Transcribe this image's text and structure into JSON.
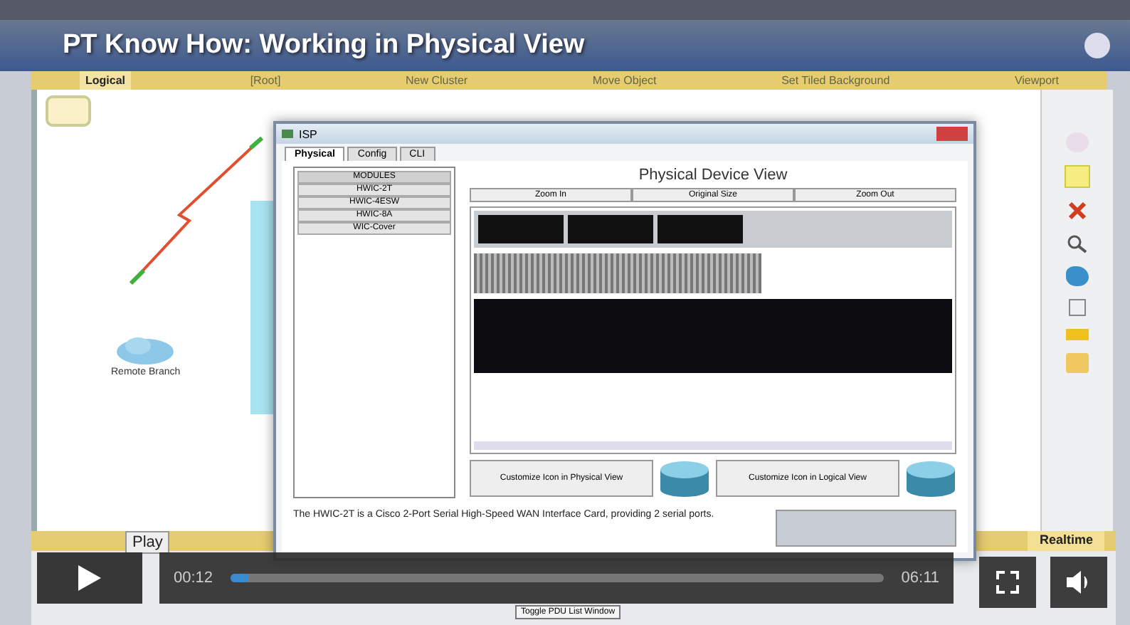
{
  "video_title": "PT Know How: Working in Physical View",
  "toolbar": {
    "items": [
      {
        "label": "Logical",
        "selected": true
      },
      {
        "label": "[Root]",
        "selected": false
      },
      {
        "label": "New Cluster",
        "selected": false
      },
      {
        "label": "Move Object",
        "selected": false
      },
      {
        "label": "Set Tiled Background",
        "selected": false
      },
      {
        "label": "Viewport",
        "selected": false
      }
    ]
  },
  "workspace": {
    "device_label": "Remote Branch"
  },
  "dialog": {
    "title": "ISP",
    "tabs": [
      {
        "label": "Physical",
        "selected": true
      },
      {
        "label": "Config",
        "selected": false
      },
      {
        "label": "CLI",
        "selected": false
      }
    ],
    "modules": [
      {
        "label": "MODULES",
        "kind": "header"
      },
      {
        "label": "HWIC-2T",
        "kind": "item"
      },
      {
        "label": "HWIC-4ESW",
        "kind": "item"
      },
      {
        "label": "HWIC-8A",
        "kind": "item"
      },
      {
        "label": "WIC-Cover",
        "kind": "item"
      }
    ],
    "view_title": "Physical Device View",
    "zoom_buttons": [
      "Zoom In",
      "Original Size",
      "Zoom Out"
    ],
    "customize_buttons": [
      "Customize Icon in Physical View",
      "Customize Icon in Logical View"
    ],
    "description": "The HWIC-2T is a Cisco 2-Port Serial High-Speed WAN Interface Card, providing 2 serial ports."
  },
  "mode_label": "Realtime",
  "bottom_button": "Toggle PDU List Window",
  "player": {
    "tooltip": "Play",
    "elapsed": "00:12",
    "duration": "06:11",
    "level": 0.03
  }
}
